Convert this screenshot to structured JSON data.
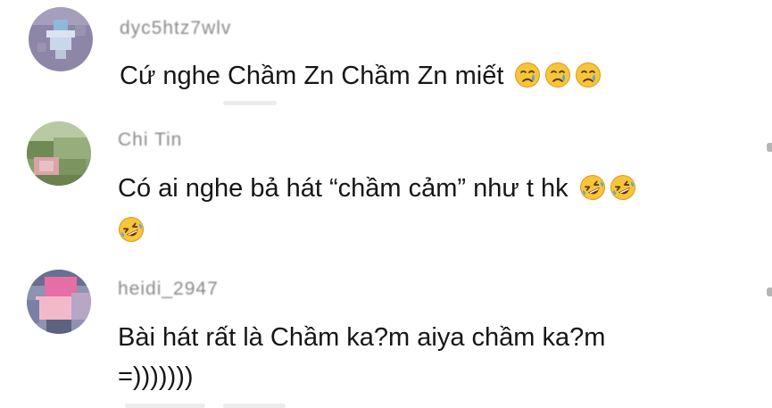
{
  "comments": [
    {
      "username": "dyc5htz7wlv",
      "text": "Cứ nghe Chầm Zn Chầm Zn miết",
      "emojis": [
        "crying-face-icon",
        "crying-face-icon",
        "crying-face-icon"
      ]
    },
    {
      "username": "Chi Tin",
      "text": "Có ai nghe bả hát “chầm cảm” như t hk",
      "emojis": [
        "rofl-face-icon",
        "rofl-face-icon",
        "rofl-face-icon"
      ]
    },
    {
      "username": "heidi_2947",
      "text_line1": "Bài hát rất là Chầm ka?m aiya chầm ka?m",
      "text_line2": "=)))))))"
    }
  ],
  "colors": {
    "background": "#ffffff",
    "username": "#8a8a8a",
    "text": "#161616",
    "emoji_face": "#f7c53a",
    "tear": "#4aa6e8"
  }
}
